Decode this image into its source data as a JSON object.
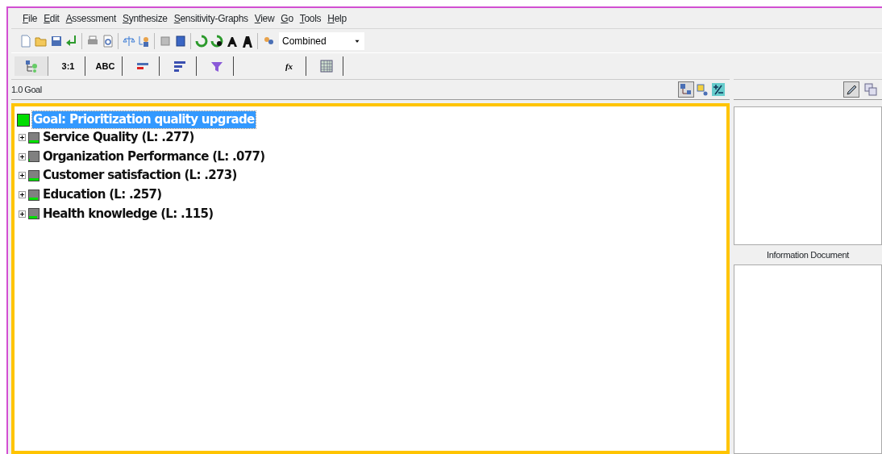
{
  "menu": [
    {
      "label": "File"
    },
    {
      "label": "Edit"
    },
    {
      "label": "Assessment"
    },
    {
      "label": "Synthesize"
    },
    {
      "label": "Sensitivity-Graphs"
    },
    {
      "label": "View"
    },
    {
      "label": "Go"
    },
    {
      "label": "Tools"
    },
    {
      "label": "Help"
    }
  ],
  "toolbar": {
    "mode_dropdown": {
      "value": "Combined"
    }
  },
  "tabs": [
    {
      "kind": "tree",
      "selected": true
    },
    {
      "kind": "text",
      "label": "3:1",
      "selected": false
    },
    {
      "kind": "text",
      "label": "ABC",
      "selected": false
    },
    {
      "kind": "bars-red",
      "selected": false
    },
    {
      "kind": "bars",
      "selected": false
    },
    {
      "kind": "funnel",
      "selected": false
    },
    {
      "kind": "formula",
      "label": "fx",
      "selected": false
    },
    {
      "kind": "grid",
      "selected": false
    }
  ],
  "model_panel": {
    "title": "1.0 Goal",
    "view_buttons": [
      {
        "kind": "tree",
        "selected": true
      },
      {
        "kind": "node",
        "selected": false
      },
      {
        "kind": "plusminus",
        "selected": false
      }
    ],
    "tree": {
      "label": "Goal: Prioritization quality upgrade",
      "selected": true,
      "children": [
        {
          "label": "Service Quality (L: .277)",
          "expanded": false,
          "level": 1
        },
        {
          "label": "Organization Performance (L: .077)",
          "expanded": false,
          "level": 0.05
        },
        {
          "label": "Customer satisfaction (L: .273)",
          "expanded": false,
          "level": 0.98
        },
        {
          "label": "Education (L: .257)",
          "expanded": false,
          "level": 0.93
        },
        {
          "label": "Health knowledge (L: .115)",
          "expanded": false,
          "level": 0.8
        }
      ]
    }
  },
  "side_panel": {
    "buttons": [
      {
        "kind": "edit",
        "selected": true
      },
      {
        "kind": "compare",
        "selected": false
      }
    ],
    "document_title": "Information Document"
  }
}
